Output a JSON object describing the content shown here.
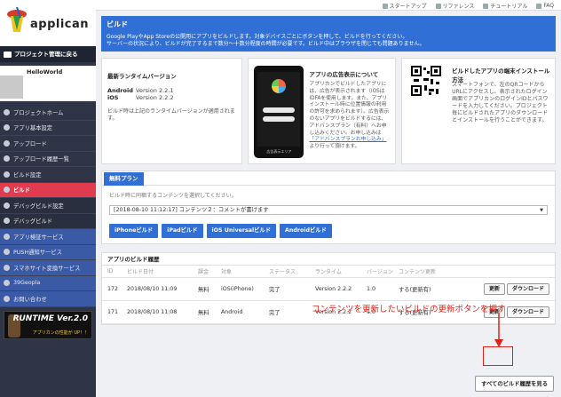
{
  "app": {
    "logo_text": "applican"
  },
  "topnav": [
    "スタートアップ",
    "リファレンス",
    "チュートリアル",
    "FAQ"
  ],
  "sidebar": {
    "back_label": "プロジェクト管理に戻る",
    "project_name": "HelloWorld",
    "items": [
      {
        "label": "プロジェクトホーム",
        "state": "normal"
      },
      {
        "label": "アプリ基本設定",
        "state": "normal"
      },
      {
        "label": "アップロード",
        "state": "normal"
      },
      {
        "label": "アップロード履歴一覧",
        "state": "normal"
      },
      {
        "label": "ビルド設定",
        "state": "normal"
      },
      {
        "label": "ビルド",
        "state": "active"
      },
      {
        "label": "デバッグビルド設定",
        "state": "sub"
      },
      {
        "label": "デバッグビルド",
        "state": "sub"
      },
      {
        "label": "アプリ検証サービス",
        "state": "blue"
      },
      {
        "label": "PUSH通知サービス",
        "state": "blue"
      },
      {
        "label": "スマホサイト変換サービス",
        "state": "blue"
      },
      {
        "label": "39Geopla",
        "state": "blue"
      },
      {
        "label": "お問い合わせ",
        "state": "blue"
      }
    ],
    "banner": {
      "title": "RUNTIME Ver.2.0",
      "subtitle": "アプリカンの性能が UP！！"
    }
  },
  "main": {
    "title": "ビルド",
    "desc1": "Google PlayやApp Storeの公開用にアプリをビルドします。対象デバイスごとにボタンを押して、ビルドを行ってください。",
    "desc2": "サーバーの状況により、ビルドが完了するまで数分〜十数分程度の時間が必要です。ビルド中はブラウザを閉じても問題ありません。",
    "runtime_card": {
      "heading": "最新ランタイムバージョン",
      "rows": [
        {
          "k": "Android",
          "v": "Version 2.2.1"
        },
        {
          "k": "iOS",
          "v": "Version 2.2.2"
        }
      ],
      "note": "ビルド時は上記のランタイムバージョンが適用されます。"
    },
    "ad_card": {
      "heading": "アプリの広告表示について",
      "body": "アプリカンでビルドしたアプリには、広告が表示されます（iOSはIDFAを使用します。また、アプリインストール時に位置情報の利用の許可を求められます）。広告表示のないアプリをビルドするには、アドバンスプラン（有料）へお申し込みください。お申し込みは",
      "link": "「アドバンスプランお申し込み」",
      "tail": "より行って頂けます。",
      "phone_ad": "広告表示エリア"
    },
    "install_card": {
      "heading": "ビルドしたアプリの端末インストール方法",
      "body": "スマートフォンで、左のQRコードからURLにアクセスし、表示されたログイン画面でアプリカンのログインIDとパスワードを入力してください。プロジェクト毎にビルドされたアプリのダウンロードとインストールを行うことができます。"
    },
    "plan": {
      "tab": "無料プラン",
      "hint": "ビルド時に同梱するコンテンツを選択してください。",
      "selected": "[2018-08-10 11:12:17] コンテンツ２：コメントが書けます",
      "buttons": [
        "iPhoneビルド",
        "iPadビルド",
        "iOS Universalビルド",
        "Androidビルド"
      ]
    },
    "history": {
      "title": "アプリのビルド履歴",
      "columns": [
        "ID",
        "ビルド日付",
        "課金",
        "対象",
        "ステータス",
        "ランタイム",
        "バージョン",
        "コンテンツ更新",
        ""
      ],
      "rows": [
        {
          "id": "172",
          "date": "2018/08/10 11:09",
          "fee": "無料",
          "target": "iOS(iPhone)",
          "status": "完了",
          "runtime": "Version 2.2.2",
          "version": "1.0",
          "update": "する(更新有)"
        },
        {
          "id": "171",
          "date": "2018/08/10 11:08",
          "fee": "無料",
          "target": "Android",
          "status": "完了",
          "runtime": "Version 2.2.2",
          "version": "1.0",
          "update": "する(更新有)"
        }
      ],
      "update_label": "更新",
      "download_label": "ダウンロード",
      "all_button": "すべてのビルド履歴を見る"
    },
    "annotation": "コンテンツを更新したいビルドの更新ボタンを押す",
    "annotation_color": "#e2231a"
  }
}
